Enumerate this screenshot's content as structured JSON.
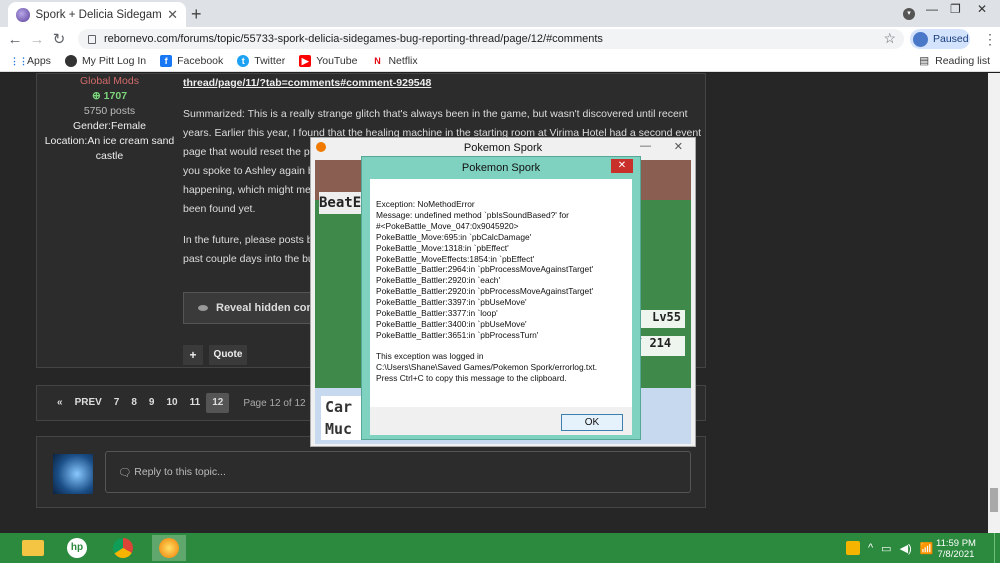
{
  "browser": {
    "tab_title": "Spork + Delicia Sidegames Bug R",
    "url": "rebornevo.com/forums/topic/55733-spork-delicia-sidegames-bug-reporting-thread/page/12/#comments",
    "profile_label": "Paused",
    "bookmarks": [
      "Apps",
      "My Pitt Log In",
      "Facebook",
      "Twitter",
      "YouTube",
      "Netflix"
    ],
    "reading_list": "Reading list"
  },
  "post": {
    "author_group": "Global Mods",
    "reputation": "1707",
    "post_count": "5750 posts",
    "gender": "Gender:Female",
    "location": "Location:An ice cream sand castle",
    "link_text": "thread/page/11/?tab=comments#comment-929548",
    "para1": "Summarized: This is a really strange glitch that's always been in the game, but wasn't discovered until recent years. Earlier this year, I found that the healing machine in the starting room at Virima Hotel had a second event page that would reset the p",
    "para1_line3": "you spoke to Ashley again b",
    "para1_line4": "happening, which might me",
    "para1_line5": "been found yet.",
    "para2_line1": "In the future, please posts b",
    "para2_line2": "past couple days into the bu",
    "reveal_label": "Reveal hidden conten",
    "plus_label": "+",
    "quote_label": "Quote"
  },
  "pager": {
    "prev_label": "PREV",
    "pages": [
      "7",
      "8",
      "9",
      "10",
      "11",
      "12"
    ],
    "current": "12",
    "page_of": "Page 12 of 12"
  },
  "reply": {
    "placeholder": "Reply to this topic..."
  },
  "game": {
    "title": "Pokemon Spork",
    "beat_text": "BeatE",
    "level": "Lv55",
    "hp": "/ 214",
    "bottom_text_1": "Car",
    "bottom_text_2": "Muc"
  },
  "dialog": {
    "title": "Pokemon Spork",
    "close_label": "✕",
    "exception": "Exception: NoMethodError",
    "message_1": "Message: undefined method `pbIsSoundBased?' for",
    "message_2": "#<PokeBattle_Move_047:0x9045920>",
    "trace": [
      "PokeBattle_Move:695:in `pbCalcDamage'",
      "PokeBattle_Move:1318:in `pbEffect'",
      "PokeBattle_MoveEffects:1854:in `pbEffect'",
      "PokeBattle_Battler:2964:in `pbProcessMoveAgainstTarget'",
      "PokeBattle_Battler:2920:in `each'",
      "PokeBattle_Battler:2920:in `pbProcessMoveAgainstTarget'",
      "PokeBattle_Battler:3397:in `pbUseMove'",
      "PokeBattle_Battler:3377:in `loop'",
      "PokeBattle_Battler:3400:in `pbUseMove'",
      "PokeBattle_Battler:3651:in `pbProcessTurn'"
    ],
    "log_1": "This exception was logged in",
    "log_2": "C:\\Users\\Shane\\Saved Games/Pokemon Spork/errorlog.txt.",
    "log_3": "Press Ctrl+C to copy this message to the clipboard.",
    "ok_label": "OK"
  },
  "taskbar": {
    "time": "11:59 PM",
    "date": "7/8/2021",
    "hp_label": "hp"
  }
}
